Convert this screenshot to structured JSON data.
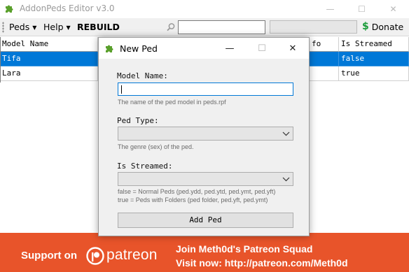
{
  "window": {
    "title": "AddonPeds Editor v3.0",
    "min_glyph": "—",
    "max_glyph": "☐",
    "close_glyph": "✕"
  },
  "menubar": {
    "peds_label": "Peds",
    "help_label": "Help",
    "rebuild_label": "REBUILD",
    "search_value": "",
    "donate_label": "Donate",
    "dropdown_glyph": "▼",
    "dollar_glyph": "$"
  },
  "grid": {
    "columns": [
      "Model Name",
      "",
      "",
      "fo",
      "Is Streamed"
    ],
    "rows": [
      {
        "model_name": "Tifa",
        "is_streamed": "false",
        "selected": true
      },
      {
        "model_name": "Lara",
        "is_streamed": "true",
        "selected": false
      }
    ]
  },
  "dialog": {
    "title": "New Ped",
    "min_glyph": "—",
    "max_glyph": "☐",
    "close_glyph": "✕",
    "model_name_label": "Model Name:",
    "model_name_value": "",
    "model_name_hint": "The name of the ped model in peds.rpf",
    "ped_type_label": "Ped Type:",
    "ped_type_value": "",
    "ped_type_hint": "The genre (sex) of the ped.",
    "is_streamed_label": "Is Streamed:",
    "is_streamed_value": "",
    "is_streamed_hint_1": "false = Normal Peds (ped.ydd, ped.ytd, ped.ymt, ped.yft)",
    "is_streamed_hint_2": "true = Peds with Folders (ped folder, ped.yft, ped.ymt)",
    "add_button_label": "Add Ped"
  },
  "banner": {
    "support_text": "Support on",
    "brand_text": "patreon",
    "line1": "Join Meth0d's Patreon Squad",
    "line2": "Visit now: http://patreon.com/Meth0d"
  },
  "colors": {
    "selection": "#0078d7",
    "banner": "#e8542a",
    "accent_green": "#1a9c3a",
    "focus_border": "#0078d7"
  },
  "icons": [
    "puzzle-icon",
    "search-icon",
    "dollar-icon",
    "chevron-down-icon",
    "patreon-logo-icon",
    "close-icon",
    "minimize-icon",
    "maximize-icon"
  ]
}
